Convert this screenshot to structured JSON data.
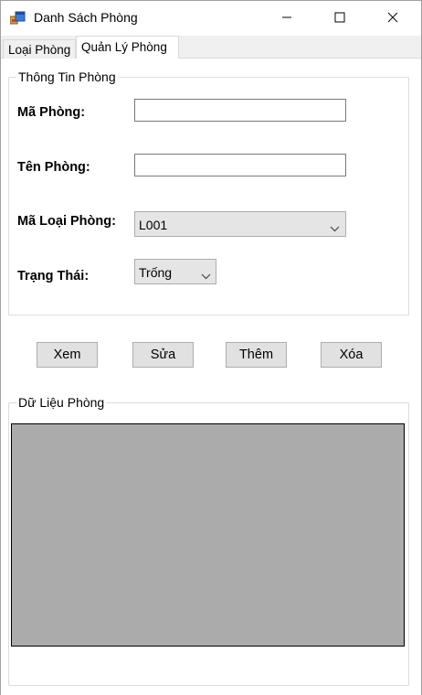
{
  "window": {
    "title": "Danh Sách Phòng"
  },
  "tabs": [
    {
      "label": "Loại Phòng",
      "selected": false
    },
    {
      "label": "Quản Lý Phòng",
      "selected": true
    }
  ],
  "info_group": {
    "title": "Thông Tin Phòng",
    "ma_phong": {
      "label": "Mã Phòng:",
      "value": ""
    },
    "ten_phong": {
      "label": "Tên Phòng:",
      "value": ""
    },
    "ma_loai_phong": {
      "label": "Mã Loại Phòng:",
      "selected": "L001"
    },
    "trang_thai": {
      "label": "Trạng Thái:",
      "selected": "Trống"
    }
  },
  "buttons": {
    "xem": "Xem",
    "sua": "Sửa",
    "them": "Thêm",
    "xoa": "Xóa"
  },
  "data_group": {
    "title": "Dữ Liệu Phòng"
  },
  "colors": {
    "grid_background": "#ababab",
    "button_face": "#e1e1e1",
    "combo_face": "#e5e5e5"
  },
  "icons": {
    "app": "app-form-icon",
    "minimize": "minimize-icon",
    "maximize": "maximize-icon",
    "close": "close-icon",
    "dropdown": "chevron-down-icon"
  }
}
